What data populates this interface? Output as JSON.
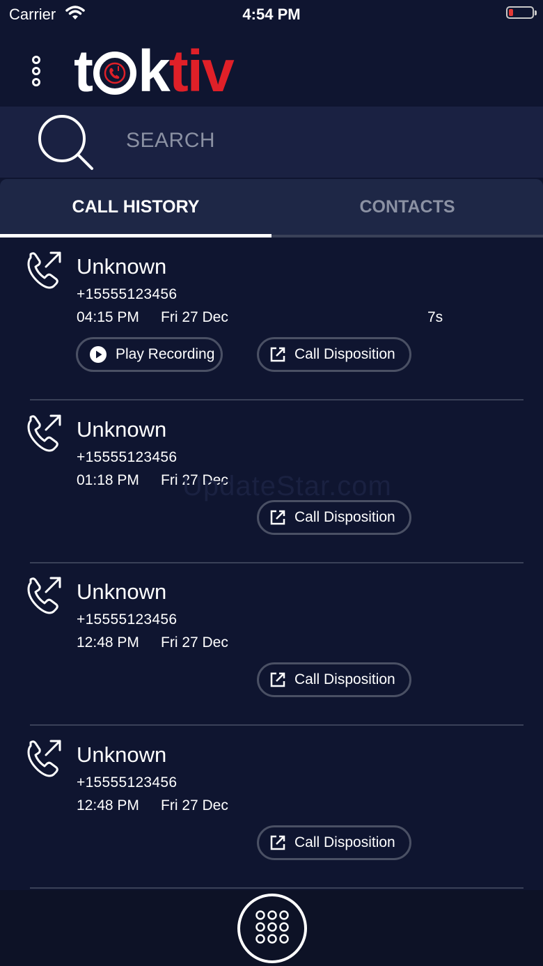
{
  "status_bar": {
    "carrier": "Carrier",
    "time": "4:54 PM",
    "wifi_icon": "wifi-icon",
    "battery_icon": "battery-low-icon"
  },
  "header": {
    "menu_icon": "more-vertical-icon",
    "logo_text_white_1": "t",
    "logo_text_white_2": "k",
    "logo_text_red": "tiv",
    "accent_color": "#e02028"
  },
  "search": {
    "placeholder": "SEARCH",
    "icon": "search-icon"
  },
  "tabs": [
    {
      "label": "CALL HISTORY",
      "active": true
    },
    {
      "label": "CONTACTS",
      "active": false
    }
  ],
  "calls": [
    {
      "name": "Unknown",
      "number": "+15555123456",
      "time": "04:15 PM",
      "date": "Fri 27 Dec",
      "duration": "7s",
      "play_label": "Play Recording",
      "dispo_label": "Call Disposition"
    },
    {
      "name": "Unknown",
      "number": "+15555123456",
      "time": "01:18 PM",
      "date": "Fri 27 Dec",
      "dispo_label": "Call Disposition"
    },
    {
      "name": "Unknown",
      "number": "+15555123456",
      "time": "12:48 PM",
      "date": "Fri 27 Dec",
      "dispo_label": "Call Disposition"
    },
    {
      "name": "Unknown",
      "number": "+15555123456",
      "time": "12:48 PM",
      "date": "Fri 27 Dec",
      "dispo_label": "Call Disposition"
    }
  ],
  "watermark": "UpdateStar.com",
  "bottom": {
    "dialpad_icon": "dialpad-icon"
  },
  "colors": {
    "background": "#0f1530",
    "panel": "#1a2142",
    "muted_text": "#8b91a3"
  }
}
